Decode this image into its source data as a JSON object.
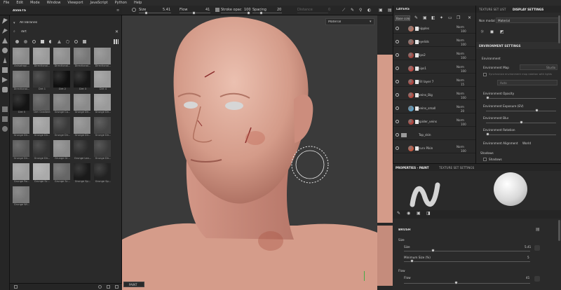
{
  "menu": [
    "File",
    "Edit",
    "Mode",
    "Window",
    "Viewport",
    "JavaScript",
    "Python",
    "Help"
  ],
  "toolbar": {
    "size_label": "Size",
    "size_value": "5.41",
    "flow_label": "Flow",
    "flow_value": "41",
    "stroke_opac_label": "Stroke opac",
    "stroke_opac_value": "100",
    "spacing_label": "Spacing",
    "spacing_value": "20",
    "distance_label": "Distance",
    "distance_value": "0"
  },
  "assets": {
    "title": "ASSETS",
    "library": "All libraries",
    "search_value": "dirt",
    "thumbs": [
      {
        "label": "Anisotropi...",
        "color": "#8a8a8a"
      },
      {
        "label": "Directional...",
        "color": "#9a9a9a"
      },
      {
        "label": "Directional...",
        "color": "#8e8e8e"
      },
      {
        "label": "Directional...",
        "color": "#777"
      },
      {
        "label": "Directional...",
        "color": "#8c8c8c"
      },
      {
        "label": "Directional...",
        "color": "#6f6f6f"
      },
      {
        "label": "Dirt 1",
        "color": "#353535"
      },
      {
        "label": "Dirt 2",
        "color": "#0f0f0f"
      },
      {
        "label": "Dirt 3",
        "color": "#161616"
      },
      {
        "label": "Dirt 4",
        "color": "#9a9a9a"
      },
      {
        "label": "Dirt 5",
        "color": "#141414"
      },
      {
        "label": "Dirt Gradient",
        "color": "#5a5a5a"
      },
      {
        "label": "Grunge Co...",
        "color": "#7c7c7c"
      },
      {
        "label": "Grunge Dir...",
        "color": "#8a8a8a"
      },
      {
        "label": "Grunge Dir...",
        "color": "#9a9a9a"
      },
      {
        "label": "Grunge Dir...",
        "color": "#7a7a7a"
      },
      {
        "label": "Grunge Dir...",
        "color": "#a0a0a0"
      },
      {
        "label": "Grunge Dir...",
        "color": "#3a3a3a"
      },
      {
        "label": "Grunge Dir...",
        "color": "#8c8c8c"
      },
      {
        "label": "Grunge Dir...",
        "color": "#444"
      },
      {
        "label": "Grunge Dir...",
        "color": "#555"
      },
      {
        "label": "Grunge Dir...",
        "color": "#333"
      },
      {
        "label": "Grunge Gr...",
        "color": "#8a8a8a"
      },
      {
        "label": "Grunge Lea...",
        "color": "#2a2a2a"
      },
      {
        "label": "Grunge Dir...",
        "color": "#3a3a3a"
      },
      {
        "label": "Grunge Ro...",
        "color": "#9a9a9a"
      },
      {
        "label": "Grunge Sc...",
        "color": "#aaa"
      },
      {
        "label": "Grunge Sc...",
        "color": "#666"
      },
      {
        "label": "Grunge Sp...",
        "color": "#1a1a1a"
      },
      {
        "label": "Grunge Sp...",
        "color": "#222"
      },
      {
        "label": "Grunge Wi...",
        "color": "#777"
      }
    ]
  },
  "viewport": {
    "mode": "Material",
    "camera": "PAINT"
  },
  "layers": {
    "tab": "LAYERS",
    "channel": "Base colo",
    "rows": [
      {
        "name": "nipples",
        "blend": "Norm",
        "opacity": "100",
        "ball": "#b8715f"
      },
      {
        "name": "eyelids",
        "blend": "Norm",
        "opacity": "100",
        "ball": "#9a6058"
      },
      {
        "name": "lips2",
        "blend": "Norm",
        "opacity": "100",
        "ball": "#a8443d"
      },
      {
        "name": "Lips1",
        "blend": "Norm",
        "opacity": "100",
        "ball": "#c04a44"
      },
      {
        "name": "Fill layer 7",
        "blend": "Norm",
        "opacity": "15",
        "ball": "#b0403a"
      },
      {
        "name": "veins_Big",
        "blend": "Norm",
        "opacity": "100",
        "ball": "#b8463c"
      },
      {
        "name": "veins_small",
        "blend": "Norm",
        "opacity": "20",
        "ball": "#5aa0c8"
      },
      {
        "name": "spider_veins",
        "blend": "Norm",
        "opacity": "100",
        "ball": "#b04038"
      },
      {
        "name": "Top_skin",
        "blend": "",
        "opacity": "",
        "ball": ""
      },
      {
        "name": "curv Pikin",
        "blend": "Norm",
        "opacity": "100",
        "ball": "#c85840"
      }
    ]
  },
  "texset": {
    "tab1": "TEXTURE SET LIST",
    "tab2": "DISPLAY SETTINGS",
    "nonmodal_label": "Non modal",
    "nonmodal_value": "Material",
    "section": "ENVIRONMENT SETTINGS",
    "env_label": "Environment",
    "env_map_label": "Environment Map",
    "env_map_value": "Studio",
    "sync_label": "Synchronize environment map rotation with lights",
    "auto_label": "Auto",
    "opacity_label": "Environment Opacity",
    "exposure_label": "Environment Exposure (EV)",
    "blur_label": "Environment Blur",
    "rotation_label": "Environment Rotation",
    "alignment_label": "Environment Alignment",
    "alignment_value": "World",
    "shadows_label": "Shadows",
    "shadows_check_label": "Shadows"
  },
  "props": {
    "tab1": "PROPERTIES - PAINT",
    "tab2": "TEXTURE SET SETTINGS",
    "brush_section": "BRUSH",
    "size_group": "Size",
    "size_label": "Size",
    "size_value": "5.41",
    "min_size_label": "Minimum Size (%)",
    "min_size_value": "5",
    "flow_group": "Flow",
    "flow_label": "Flow",
    "flow_value": "41"
  },
  "colors": {
    "accent": "#d0d0d0",
    "skin": "#d29a88",
    "viewport_bg": "#3a3a3a"
  }
}
